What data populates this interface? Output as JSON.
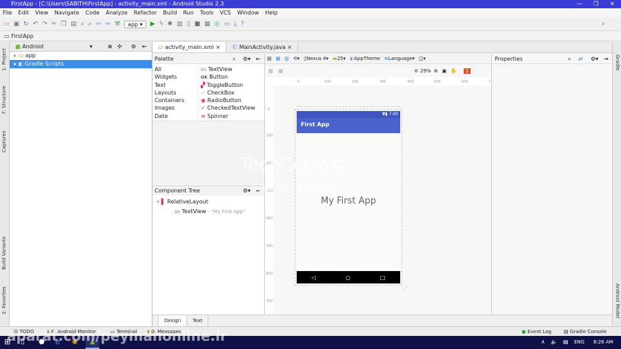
{
  "window": {
    "title": "FirstApp - [C:\\Users\\SABITH\\FirstApp] - activity_main.xml - Android Studio 2.3"
  },
  "menu": [
    "File",
    "Edit",
    "View",
    "Navigate",
    "Code",
    "Analyze",
    "Refactor",
    "Build",
    "Run",
    "Tools",
    "VCS",
    "Window",
    "Help"
  ],
  "toolbar": {
    "run_config": "app"
  },
  "breadcrumb": "FirstApp",
  "left_stripe": [
    "1: Project",
    "7: Structure",
    "Captures",
    "Build Variants",
    "2: Favorites"
  ],
  "right_stripe": [
    "Gradle",
    "Android Model"
  ],
  "project": {
    "view": "Android",
    "items": [
      {
        "label": "app",
        "selected": false
      },
      {
        "label": "Gradle Scripts",
        "selected": true
      }
    ]
  },
  "editor_tabs": [
    {
      "label": "activity_main.xml",
      "active": true
    },
    {
      "label": "MainActivity.java",
      "active": false
    }
  ],
  "palette": {
    "title": "Palette",
    "categories": [
      "All",
      "Widgets",
      "Text",
      "Layouts",
      "Containers",
      "Images",
      "Date"
    ],
    "widgets": [
      {
        "icon": "Ab",
        "label": "TextView"
      },
      {
        "icon": "OK",
        "label": "Button"
      },
      {
        "icon": "▞",
        "label": "ToggleButton"
      },
      {
        "icon": "✓",
        "label": "CheckBox"
      },
      {
        "icon": "◉",
        "label": "RadioButton"
      },
      {
        "icon": "✓",
        "label": "CheckedTextView"
      },
      {
        "icon": "≡",
        "label": "Spinner"
      }
    ]
  },
  "component_tree": {
    "title": "Component Tree",
    "root": "RelativeLayout",
    "child": "TextView",
    "child_text": "- \"My First App\""
  },
  "design_toolbar": {
    "device": "Nexus 4",
    "api": "25",
    "theme": "AppTheme",
    "language": "Language",
    "zoom": "29%",
    "warnings": "1"
  },
  "ruler_x": [
    "0",
    "100",
    "200",
    "300",
    "400",
    "500",
    "600",
    "7"
  ],
  "ruler_y": [
    "0",
    "100",
    "200",
    "300",
    "400",
    "500",
    "600",
    "700"
  ],
  "phone": {
    "time": "7:00",
    "app_title": "First App",
    "content_text": "My First App",
    "appbar_color": "#4a62cc"
  },
  "properties": {
    "title": "Properties"
  },
  "bottom_tabs": [
    "Design",
    "Text"
  ],
  "tool_windows": {
    "left": [
      "TODO",
      "6: Android Monitor",
      "Terminal",
      "0: Messages"
    ],
    "right": [
      "Event Log",
      "Gradle Console"
    ]
  },
  "taskbar": {
    "lang": "ENG",
    "time": "8:26 AM"
  },
  "watermarks": [
    "TechCetro©",
    "Sabith Pkc Mnr",
    "aparat.com/peymanonline.ir"
  ]
}
